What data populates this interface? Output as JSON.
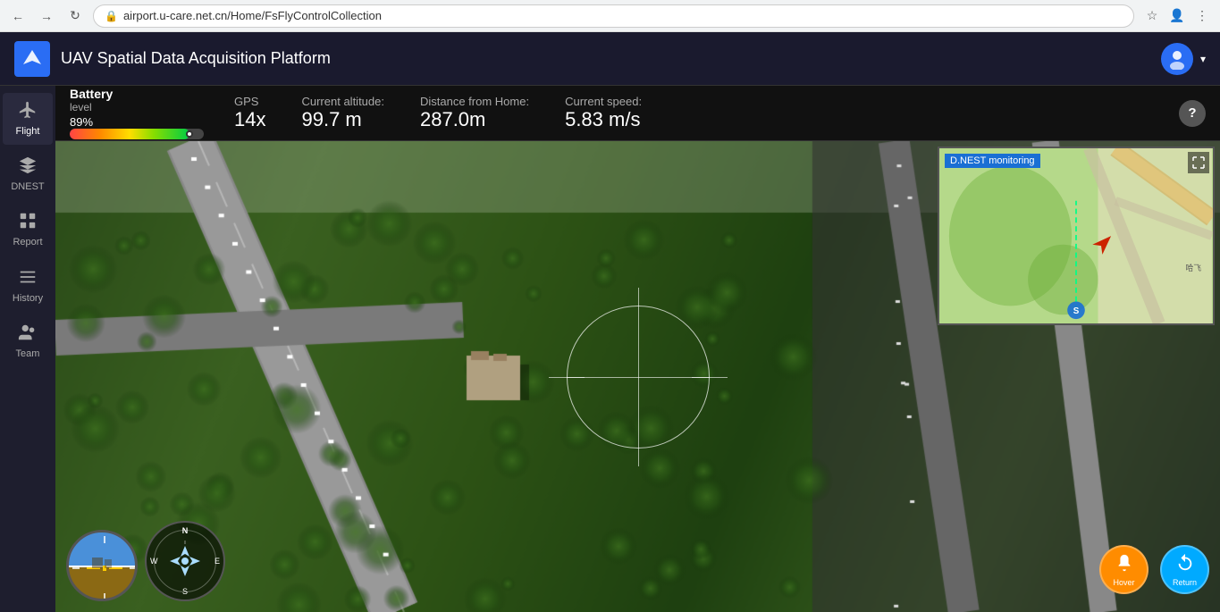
{
  "browser": {
    "url": "airport.u-care.net.cn/Home/FsFlyControlCollection",
    "back_label": "←",
    "forward_label": "→",
    "refresh_label": "↻"
  },
  "app": {
    "title": "UAV Spatial Data Acquisition Platform",
    "logo_text": "✈"
  },
  "sidebar": {
    "items": [
      {
        "id": "flight",
        "label": "Flight",
        "icon": "✈"
      },
      {
        "id": "dnest",
        "label": "DNEST",
        "icon": "⬡"
      },
      {
        "id": "report",
        "label": "Report",
        "icon": "📊"
      },
      {
        "id": "history",
        "label": "History",
        "icon": "☰"
      },
      {
        "id": "team",
        "label": "Team",
        "icon": "👤"
      }
    ]
  },
  "status_bar": {
    "battery_label": "Battery",
    "battery_sub_label": "level",
    "battery_percent": "89%",
    "battery_fill_width": "89",
    "battery_indicator_left": "89",
    "gps_label": "GPS",
    "gps_value": "14x",
    "altitude_label": "Current altitude:",
    "altitude_value": "99.7 m",
    "distance_label": "Distance from Home:",
    "distance_value": "287.0m",
    "speed_label": "Current speed:",
    "speed_value": "5.83 m/s",
    "help_label": "?"
  },
  "map": {
    "label": "D.NEST monitoring",
    "expand_icon": "⛶"
  },
  "controls": {
    "hover_label": "Hover",
    "hover_icon": "🚁",
    "return_label": "Return",
    "return_icon": "↩"
  },
  "colors": {
    "accent_blue": "#2a6df4",
    "hover_orange": "#ff8c00",
    "return_cyan": "#00aaff",
    "map_label_blue": "#1a6fd4"
  }
}
